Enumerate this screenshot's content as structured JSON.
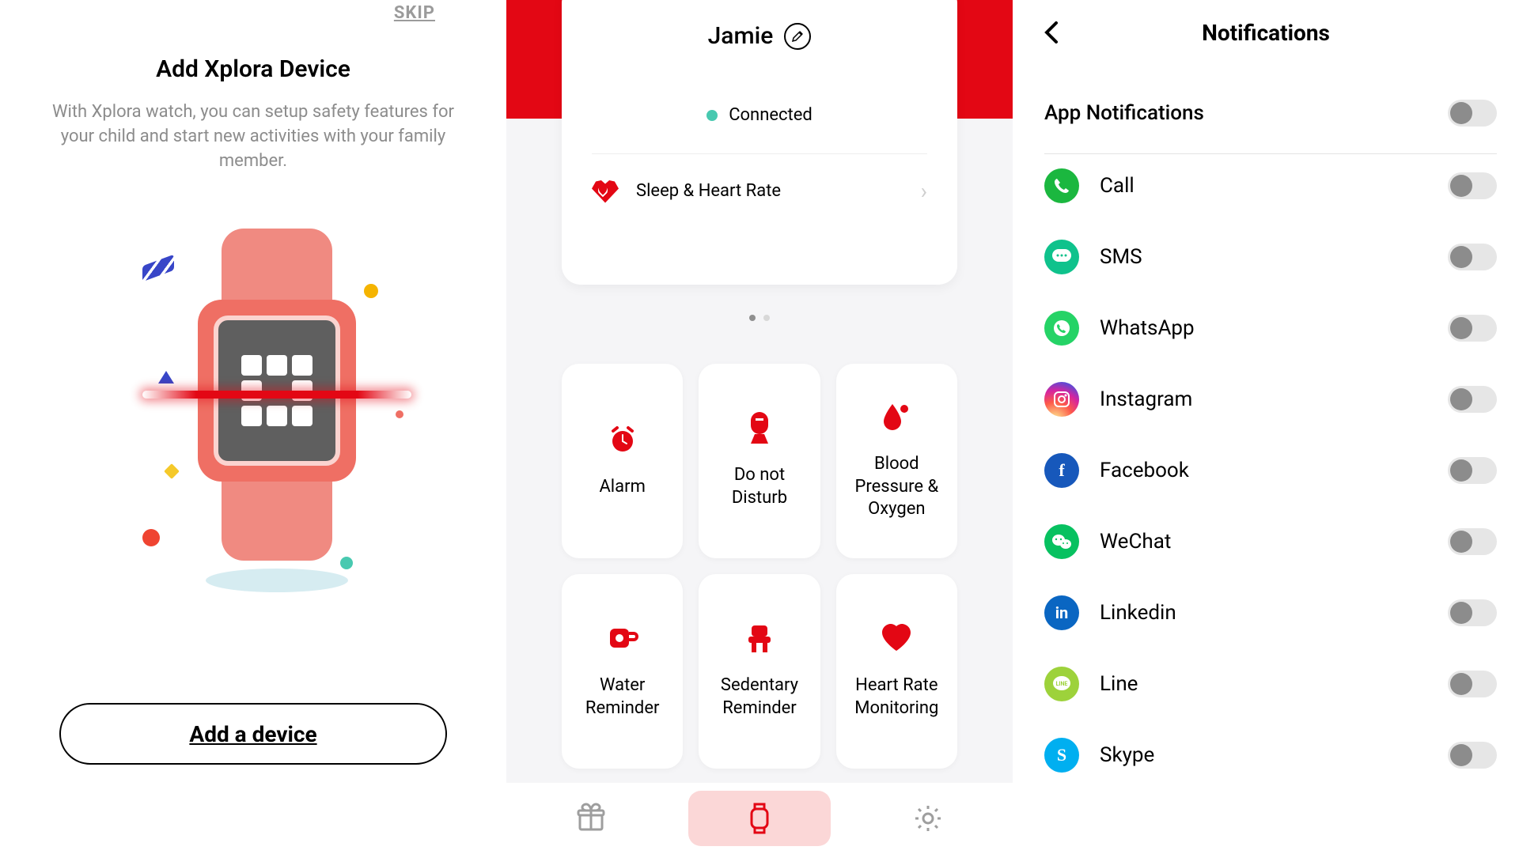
{
  "onboarding": {
    "skip": "SKIP",
    "title": "Add Xplora Device",
    "subtitle": "With Xplora watch, you can\nsetup safety features for your child and start new activities\nwith your family member.",
    "cta": "Add a device"
  },
  "dashboard": {
    "user_name": "Jamie",
    "edit_icon": "pencil-icon",
    "connection_status": "Connected",
    "sleep_row_label": "Sleep & Heart Rate",
    "pager": {
      "count": 2,
      "active": 0
    },
    "tiles": [
      {
        "icon": "alarm-icon",
        "label": "Alarm"
      },
      {
        "icon": "dnd-icon",
        "label": "Do not Disturb"
      },
      {
        "icon": "blood-icon",
        "label": "Blood Pressure & Oxygen"
      },
      {
        "icon": "water-icon",
        "label": "Water Reminder"
      },
      {
        "icon": "sedentary-icon",
        "label": "Sedentary Reminder"
      },
      {
        "icon": "heart-icon",
        "label": "Heart Rate Monitoring"
      }
    ],
    "tabs": [
      {
        "icon": "gift-icon",
        "active": false
      },
      {
        "icon": "watch-icon",
        "active": true
      },
      {
        "icon": "gear-icon",
        "active": false
      }
    ]
  },
  "notifications": {
    "title": "Notifications",
    "master_label": "App Notifications",
    "master_on": false,
    "apps": [
      {
        "name": "Call",
        "icon": "phone-icon",
        "color": "bg-green",
        "on": false
      },
      {
        "name": "SMS",
        "icon": "sms-icon",
        "color": "bg-teal",
        "on": false
      },
      {
        "name": "WhatsApp",
        "icon": "whatsapp-icon",
        "color": "bg-wa",
        "on": false
      },
      {
        "name": "Instagram",
        "icon": "instagram-icon",
        "color": "bg-ig",
        "on": false
      },
      {
        "name": "Facebook",
        "icon": "facebook-icon",
        "color": "bg-fb",
        "on": false
      },
      {
        "name": "WeChat",
        "icon": "wechat-icon",
        "color": "bg-wc",
        "on": false
      },
      {
        "name": "Linkedin",
        "icon": "linkedin-icon",
        "color": "bg-li",
        "on": false
      },
      {
        "name": "Line",
        "icon": "line-icon",
        "color": "bg-line",
        "on": false
      },
      {
        "name": "Skype",
        "icon": "skype-icon",
        "color": "bg-sk",
        "on": false
      }
    ]
  },
  "colors": {
    "brand_red": "#e30714",
    "grey_text": "#8c8c8c",
    "teal": "#48c9b0"
  }
}
